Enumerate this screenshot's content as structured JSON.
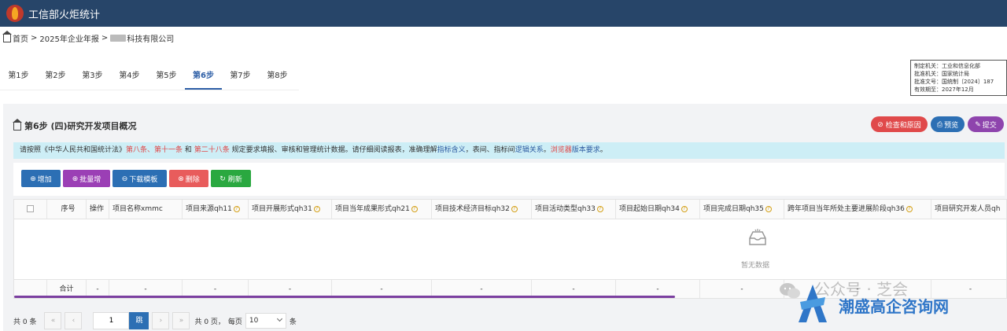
{
  "app": {
    "title": "工信部火炬统计"
  },
  "breadcrumb": {
    "home": "首页",
    "report": "2025年企业年报",
    "company_suffix": "科技有限公司"
  },
  "steps": [
    "第1步",
    "第2步",
    "第3步",
    "第4步",
    "第5步",
    "第6步",
    "第7步",
    "第8步"
  ],
  "active_step": 5,
  "infobox": {
    "line1": "制定机关：工业和信息化部",
    "line2": "批准机关：国家统计局",
    "line3": "批准文号：国统制〔2024〕187",
    "line4": "有效期至：2027年12月"
  },
  "section": {
    "title": "第6步 (四)研究开发项目概况"
  },
  "actions": {
    "check": "检查和原因",
    "preview": "预览",
    "submit": "提交"
  },
  "notice": {
    "p1": "请按照《中华人民共和国统计法》",
    "r1": "第八条、第十一条",
    "p2": " 和 ",
    "r2": "第二十八条",
    "p3": " 规定要求填报、审核和管理统计数据。请仔细阅读报表，准确理解",
    "b1": "指标含义",
    "p4": "，表间、指标间",
    "b2": "逻辑关系",
    "p5": "。",
    "r3": "浏览器",
    "b3": "版本要求",
    "p6": "。"
  },
  "toolbar": {
    "add": "增加",
    "batch_add": "批量增",
    "download_template": "下载模板",
    "delete": "删除",
    "refresh": "刷新"
  },
  "table": {
    "columns": [
      "",
      "序号",
      "操作",
      "项目名称xmmc",
      "项目来源qh11",
      "项目开展形式qh31",
      "项目当年成果形式qh21",
      "项目技术经济目标qh32",
      "项目活动类型qh33",
      "项目起始日期qh34",
      "项目完成日期qh35",
      "跨年项目当年所处主要进展阶段qh36",
      "项目研究开发人员qh"
    ],
    "help_icon_columns": [
      4,
      5,
      6,
      7,
      8,
      9,
      10,
      11
    ],
    "empty_text": "暂无数据",
    "footer": [
      "",
      "合计",
      "-",
      "-",
      "-",
      "-",
      "-",
      "-",
      "-",
      "-",
      "-",
      "-",
      "-"
    ]
  },
  "pager": {
    "total_items": "共 0 条",
    "current_page": "1",
    "go": "跳",
    "total_pages": "共 0 页，",
    "per_page_label": "每页",
    "per_page": "10",
    "unit": "条",
    "first": "«",
    "prev": "‹",
    "next": "›",
    "last": "»"
  },
  "watermark": {
    "line1": "公众号 · 芝会",
    "line2": "潮盛高企咨询网"
  },
  "colors": {
    "topbar": "#274569",
    "primary": "#2c6fb4",
    "purple": "#9b3fb5",
    "danger": "#e85c5c",
    "success": "#2aa840",
    "notice_bg": "#cdeef6"
  }
}
